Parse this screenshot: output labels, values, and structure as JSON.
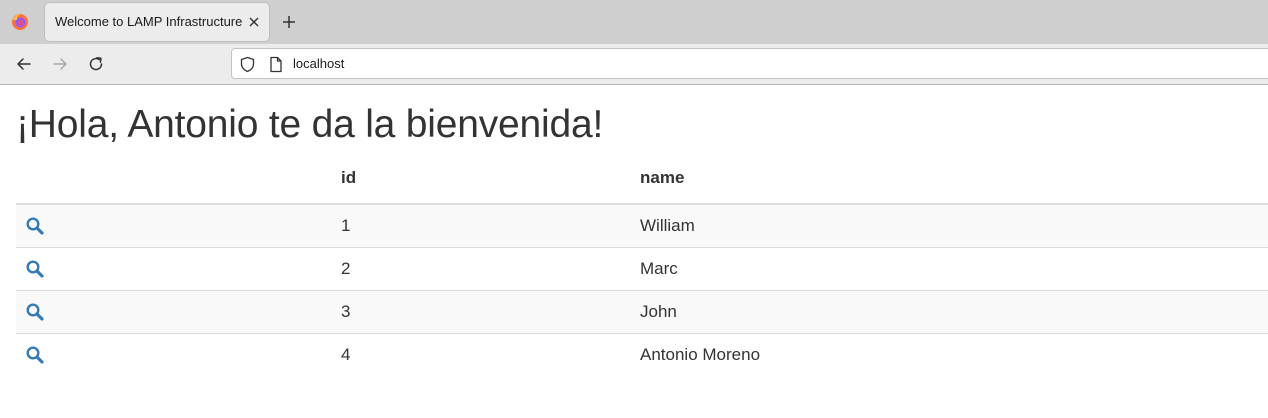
{
  "browser": {
    "tab": {
      "title": "Welcome to LAMP Infrastructure",
      "close_icon": "close-icon"
    },
    "new_tab_icon": "plus-icon",
    "nav": {
      "back_icon": "arrow-left-icon",
      "forward_icon": "arrow-right-icon",
      "reload_icon": "reload-icon"
    },
    "url": {
      "value": "localhost",
      "security_icon": "shield-icon",
      "page_icon": "page-icon"
    }
  },
  "page": {
    "title": "¡Hola, Antonio te da la bienvenida!",
    "table": {
      "columns": [
        "",
        "id",
        "name"
      ],
      "rows": [
        {
          "id": "1",
          "name": "William",
          "action_icon": "search-icon"
        },
        {
          "id": "2",
          "name": "Marc",
          "action_icon": "search-icon"
        },
        {
          "id": "3",
          "name": "John",
          "action_icon": "search-icon"
        },
        {
          "id": "4",
          "name": "Antonio Moreno",
          "action_icon": "search-icon"
        }
      ]
    }
  },
  "colors": {
    "link": "#337ab7",
    "text": "#333333",
    "stripe": "#f9f9f9",
    "border": "#dddddd"
  }
}
